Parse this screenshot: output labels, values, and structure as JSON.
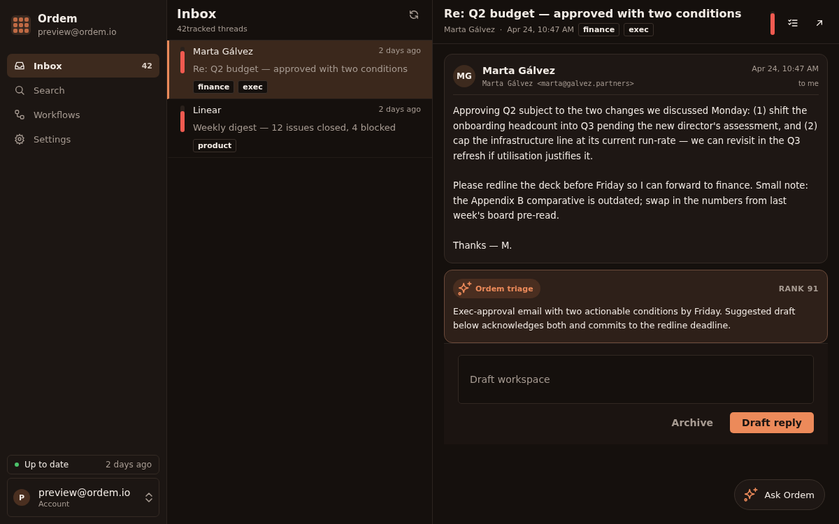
{
  "app": {
    "name": "Ordem",
    "email": "preview@ordem.io"
  },
  "nav": [
    {
      "kind": "inbox",
      "label": "Inbox",
      "count": "42",
      "selected": true
    },
    {
      "kind": "search",
      "label": "Search",
      "selected": false
    },
    {
      "kind": "workflows",
      "label": "Workflows",
      "selected": false
    },
    {
      "kind": "settings",
      "label": "Settings",
      "selected": false
    }
  ],
  "sync": {
    "status": "Up to date",
    "time": "2 days ago"
  },
  "account": {
    "initial": "P",
    "email": "preview@ordem.io",
    "role": "Account"
  },
  "list": {
    "title": "Inbox",
    "subtitle": "42tracked threads",
    "threads": [
      {
        "sender": "Marta Gálvez",
        "time": "2 days ago",
        "subject": "Re: Q2 budget — approved with two conditions",
        "tags": [
          "finance",
          "exec"
        ],
        "level": 0.85,
        "selected": true
      },
      {
        "sender": "Linear",
        "time": "2 days ago",
        "subject": "Weekly digest — 12 issues closed, 4 blocked",
        "tags": [
          "product"
        ],
        "level": 0.8,
        "selected": false
      }
    ]
  },
  "detail": {
    "subject": "Re: Q2 budget — approved with two conditions",
    "sender": "Marta Gálvez",
    "separator": "·",
    "date": "Apr 24, 10:47 AM",
    "tags": [
      "finance",
      "exec"
    ],
    "level": 0.92,
    "message": {
      "initials": "MG",
      "name": "Marta Gálvez",
      "address": "Marta Gálvez <marta@galvez.partners>",
      "date": "Apr 24, 10:47 AM",
      "recipient": "to me",
      "paragraphs": [
        "Approving Q2 subject to the two changes we discussed Monday: (1) shift the onboarding headcount into Q3 pending the new director's assessment, and (2) cap the infrastructure line at its current run-rate — we can revisit in the Q3 refresh if utilisation justifies it.",
        "Please redline the deck before Friday so I can forward to finance. Small note: the Appendix B comparative is outdated; swap in the numbers from last week's board pre-read.",
        "Thanks — M."
      ]
    },
    "triage": {
      "label": "Ordem triage",
      "rank": "RANK 91",
      "summary": "Exec-approval email with two actionable conditions by Friday. Suggested draft below acknowledges both and commits to the redline deadline."
    },
    "draft": {
      "placeholder": "Draft workspace"
    },
    "buttons": [
      {
        "kind": "secondary",
        "label": "Archive"
      },
      {
        "kind": "primary",
        "label": "Draft reply"
      }
    ]
  },
  "assistant": {
    "label": "Ask Ordem"
  }
}
